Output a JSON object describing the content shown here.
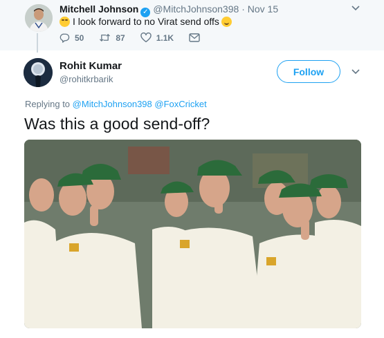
{
  "parent_tweet": {
    "name": "Mitchell Johnson",
    "handle": "@MitchJohnson398",
    "separator": "·",
    "date": "Nov 15",
    "text": "I look forward to no Virat send offs",
    "emojis": [
      "rolling-on-floor-laughing-emoji",
      "smirking-face-emoji"
    ],
    "actions": {
      "replies": "50",
      "retweets": "87",
      "likes": "1.1K"
    }
  },
  "main_tweet": {
    "name": "Rohit Kumar",
    "handle": "@rohitkrbarik",
    "follow_label": "Follow",
    "replying_prefix": "Replying to",
    "replying_to": [
      "@MitchJohnson398",
      "@FoxCricket"
    ],
    "text": "Was this a good send-off?",
    "media": "photo-cricket-team-celebration"
  },
  "colors": {
    "accent": "#1da1f2",
    "muted": "#657786",
    "parent_bg": "#f5f8fa",
    "cap_green": "#2b6b3a"
  }
}
